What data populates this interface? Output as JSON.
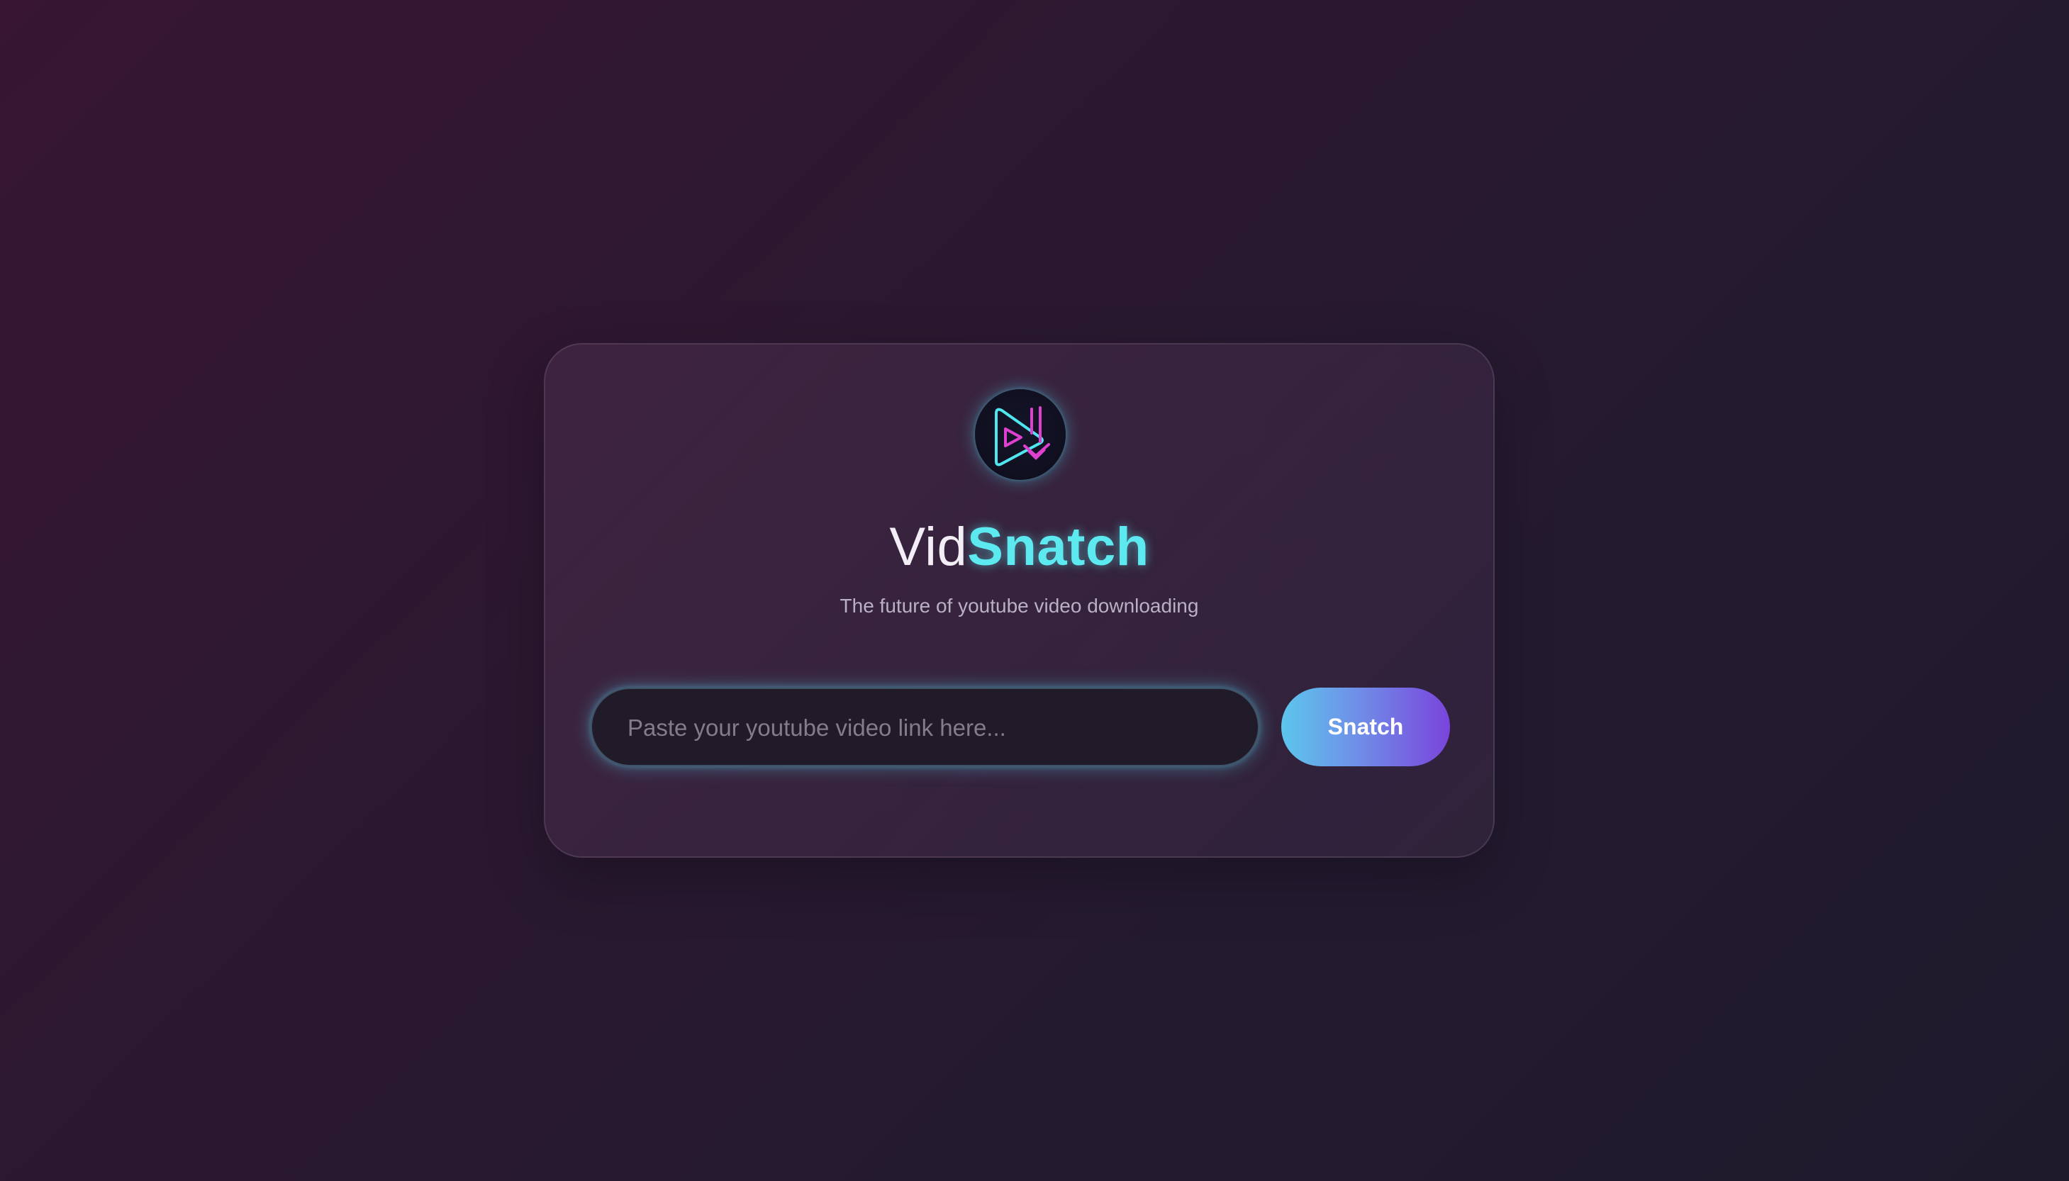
{
  "brand": {
    "title_part1": "Vid",
    "title_part2": "Snatch",
    "tagline": "The future of youtube video downloading",
    "logo_icon": "play-download-icon",
    "colors": {
      "accent_cyan": "#5ce9ef",
      "accent_magenta": "#e040d0",
      "button_gradient_start": "#5cc6ec",
      "button_gradient_end": "#7a44dc"
    }
  },
  "form": {
    "url_input": {
      "placeholder": "Paste your youtube video link here...",
      "value": ""
    },
    "submit_label": "Snatch"
  }
}
